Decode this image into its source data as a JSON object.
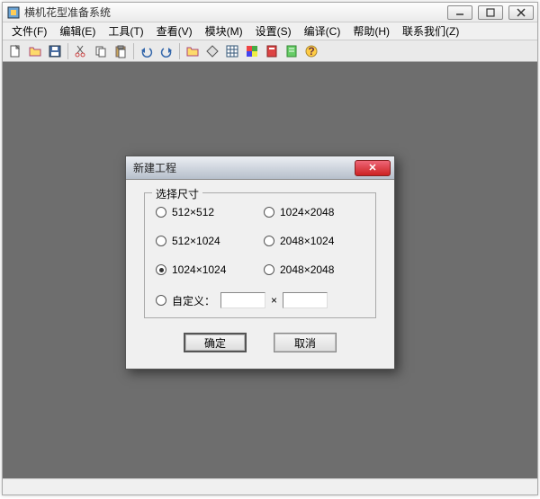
{
  "window": {
    "title": "横机花型准备系统"
  },
  "menu": {
    "file": "文件(F)",
    "edit": "编辑(E)",
    "tools": "工具(T)",
    "view": "查看(V)",
    "module": "模块(M)",
    "settings": "设置(S)",
    "compile": "编译(C)",
    "help": "帮助(H)",
    "contact": "联系我们(Z)"
  },
  "toolbar_icons": {
    "new": "new-icon",
    "open": "open-icon",
    "save": "save-icon",
    "cut": "cut-icon",
    "copy": "copy-icon",
    "paste": "paste-icon",
    "undo": "undo-icon",
    "redo": "redo-icon",
    "open2": "open2-icon",
    "grid": "grid-icon",
    "colors": "colors-icon",
    "compile": "compile-icon",
    "note": "note-icon",
    "help": "help-icon"
  },
  "dialog": {
    "title": "新建工程",
    "group_label": "选择尺寸",
    "options": {
      "s512x512": "512×512",
      "s512x1024": "512×1024",
      "s1024x1024": "1024×1024",
      "s1024x2048": "1024×2048",
      "s2048x1024": "2048×1024",
      "s2048x2048": "2048×2048",
      "custom_label": "自定义："
    },
    "selected": "s1024x1024",
    "custom_w": "",
    "custom_h": "",
    "times": "×",
    "ok": "确定",
    "cancel": "取消"
  }
}
